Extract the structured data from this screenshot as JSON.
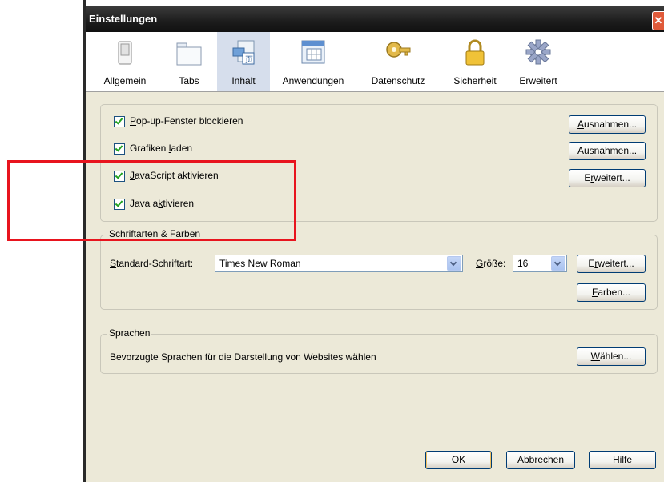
{
  "window": {
    "title": "Einstellungen",
    "close_glyph": "✕"
  },
  "toolbar": {
    "items": [
      {
        "label": "Allgemein",
        "icon": "switch-icon"
      },
      {
        "label": "Tabs",
        "icon": "tabs-icon"
      },
      {
        "label": "Inhalt",
        "icon": "content-icon",
        "selected": true
      },
      {
        "label": "Anwendungen",
        "icon": "applications-icon"
      },
      {
        "label": "Datenschutz",
        "icon": "key-icon"
      },
      {
        "label": "Sicherheit",
        "icon": "lock-icon"
      },
      {
        "label": "Erweitert",
        "icon": "gear-icon"
      }
    ]
  },
  "content": {
    "checkboxes": [
      {
        "pre": "",
        "u": "P",
        "post": "op-up-Fenster blockieren",
        "checked": true
      },
      {
        "pre": "Grafiken ",
        "u": "l",
        "post": "aden",
        "checked": true
      },
      {
        "pre": "",
        "u": "J",
        "post": "avaScript aktivieren",
        "checked": true
      },
      {
        "pre": "Java a",
        "u": "k",
        "post": "tivieren",
        "checked": true
      }
    ],
    "buttons": {
      "ausnahmen1": {
        "pre": "",
        "u": "A",
        "post": "usnahmen..."
      },
      "ausnahmen2": {
        "pre": "A",
        "u": "u",
        "post": "snahmen..."
      },
      "erweitert": {
        "pre": "E",
        "u": "r",
        "post": "weitert..."
      }
    }
  },
  "fonts": {
    "legend": "Schriftarten & Farben",
    "standard_label": {
      "pre": "",
      "u": "S",
      "post": "tandard-Schriftart:"
    },
    "font_value": "Times New Roman",
    "size_label": {
      "pre": "",
      "u": "G",
      "post": "röße:"
    },
    "size_value": "16",
    "erweitert_btn": {
      "pre": "E",
      "u": "r",
      "post": "weitert..."
    },
    "farben_btn": {
      "pre": "",
      "u": "F",
      "post": "arben..."
    }
  },
  "languages": {
    "legend": "Sprachen",
    "description": "Bevorzugte Sprachen für die Darstellung von Websites wählen",
    "choose_btn": {
      "pre": "",
      "u": "W",
      "post": "ählen..."
    }
  },
  "footer": {
    "ok": "OK",
    "cancel": "Abbrechen",
    "help": {
      "pre": "",
      "u": "H",
      "post": "ilfe"
    }
  },
  "colors": {
    "highlight_box": "#e8141e",
    "selected_tab": "#d6deec",
    "dialog_bg": "#ece9d8"
  }
}
